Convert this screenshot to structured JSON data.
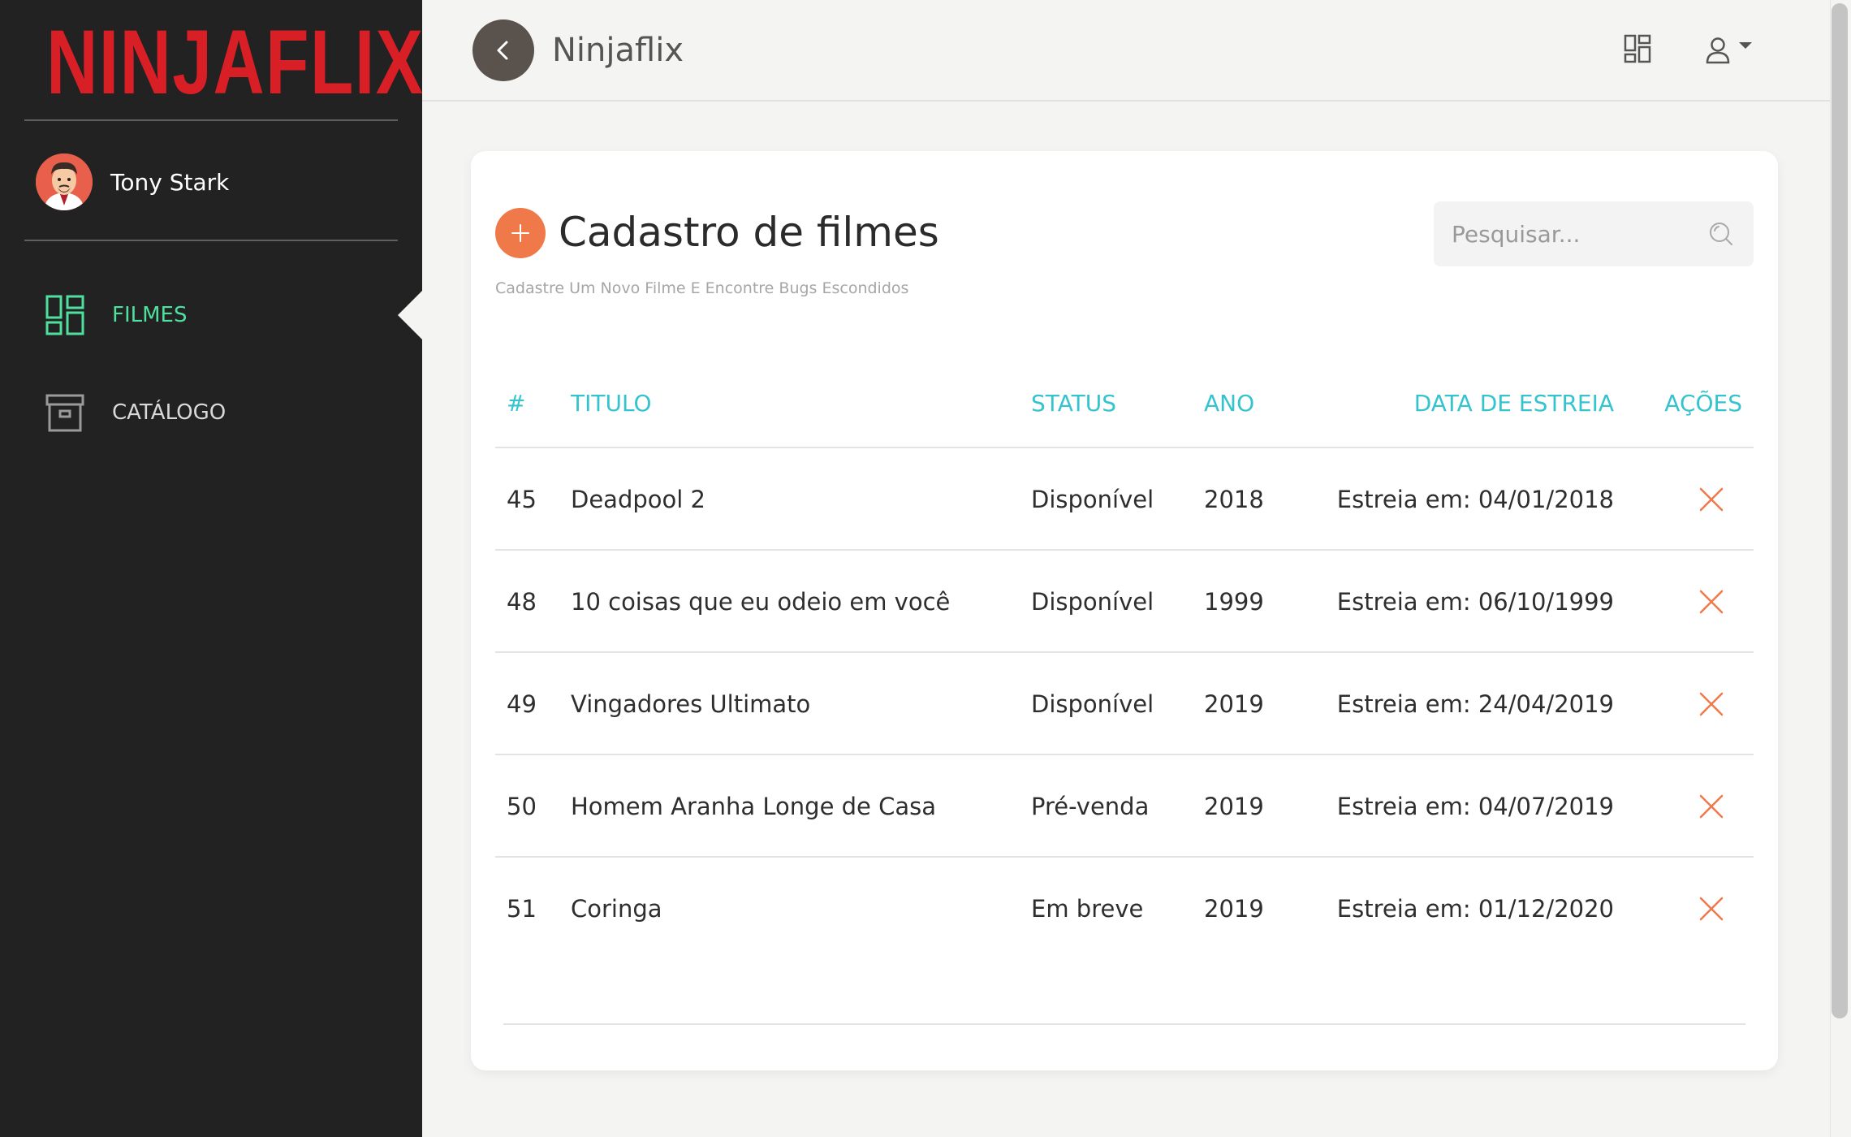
{
  "app": {
    "logo_text": "NINJAFLIX",
    "title": "Ninjaflix"
  },
  "sidebar": {
    "user_name": "Tony Stark",
    "items": [
      {
        "label": "FILMES",
        "icon": "dashboard-grid-icon",
        "active": true
      },
      {
        "label": "CATÁLOGO",
        "icon": "archive-box-icon",
        "active": false
      }
    ]
  },
  "header": {
    "back_icon": "chevron-left-icon",
    "grid_icon": "dashboard-grid-icon",
    "user_icon": "user-icon"
  },
  "page": {
    "title": "Cadastro de filmes",
    "subtitle": "Cadastre Um Novo Filme E Encontre Bugs Escondidos",
    "add_icon": "plus-icon",
    "search": {
      "placeholder": "Pesquisar...",
      "value": ""
    }
  },
  "table": {
    "headers": {
      "id": "#",
      "title": "TITULO",
      "status": "STATUS",
      "year": "ANO",
      "release": "DATA DE ESTREIA",
      "actions": "AÇÕES"
    },
    "rows": [
      {
        "id": "45",
        "title": "Deadpool 2",
        "status": "Disponível",
        "year": "2018",
        "release": "Estreia em: 04/01/2018"
      },
      {
        "id": "48",
        "title": "10 coisas que eu odeio em você",
        "status": "Disponível",
        "year": "1999",
        "release": "Estreia em: 06/10/1999"
      },
      {
        "id": "49",
        "title": "Vingadores Ultimato",
        "status": "Disponível",
        "year": "2019",
        "release": "Estreia em: 24/04/2019"
      },
      {
        "id": "50",
        "title": "Homem Aranha Longe de Casa",
        "status": "Pré-venda",
        "year": "2019",
        "release": "Estreia em: 04/07/2019"
      },
      {
        "id": "51",
        "title": "Coringa",
        "status": "Em breve",
        "year": "2019",
        "release": "Estreia em: 01/12/2020"
      }
    ]
  },
  "colors": {
    "sidebar_bg": "#222222",
    "logo_red": "#d81f26",
    "active_green": "#4fe0a0",
    "header_teal": "#35c3cf",
    "accent_orange": "#f0794a"
  }
}
